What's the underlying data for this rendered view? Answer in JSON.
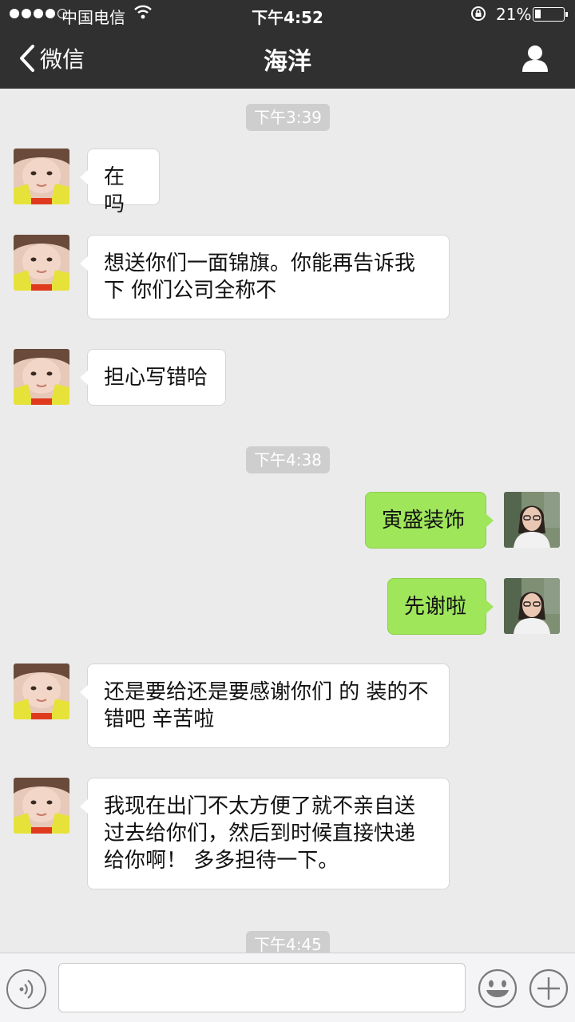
{
  "status": {
    "carrier": "中国电信",
    "time": "下午4:52",
    "battery": "21%",
    "battery_level": 0.21
  },
  "nav": {
    "back_label": "微信",
    "title": "海洋"
  },
  "chat": {
    "stamps": [
      "下午3:39",
      "下午4:38",
      "下午4:45"
    ],
    "messages": [
      {
        "from": "contact",
        "text": "在吗"
      },
      {
        "from": "contact",
        "text": "想送你们一面锦旗。你能再告诉我下 你们公司全称不"
      },
      {
        "from": "contact",
        "text": "担心写错哈"
      },
      {
        "from": "self",
        "text": "寅盛装饰"
      },
      {
        "from": "self",
        "text": "先谢啦"
      },
      {
        "from": "contact",
        "text": "还是要给还是要感谢你们 的 装的不错吧 辛苦啦"
      },
      {
        "from": "contact",
        "text": "我现在出门不太方便了就不亲自送过去给你们，然后到时候直接快递给你啊！ 多多担待一下。"
      }
    ]
  },
  "input": {
    "value": ""
  },
  "icons": {
    "back": "chevron-left-icon",
    "profile": "person-icon",
    "voice": "voice-icon",
    "emoji": "emoji-icon",
    "plus": "plus-icon"
  },
  "colors": {
    "nav_bg": "#303030",
    "outgoing_bubble": "#9fe65b",
    "chat_bg": "#ebebeb"
  }
}
